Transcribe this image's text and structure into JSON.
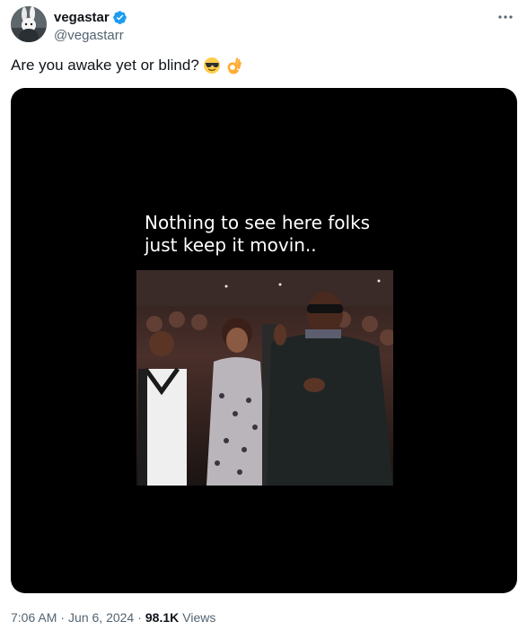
{
  "author": {
    "display_name": "vegastar",
    "handle": "@vegastarr",
    "verified": true,
    "verified_color": "#1d9bf0"
  },
  "more_icon": "more-horizontal-icon",
  "tweet": {
    "text": "Are you awake yet or blind?",
    "emojis": [
      "smiling-face-with-sunglasses",
      "ok-hand"
    ]
  },
  "media": {
    "type": "video",
    "caption_lines": [
      "Nothing to see here folks",
      "just keep it movin.."
    ]
  },
  "meta": {
    "time": "7:06 AM",
    "separator": "·",
    "date": "Jun 6, 2024",
    "views_count": "98.1K",
    "views_label": "Views"
  }
}
